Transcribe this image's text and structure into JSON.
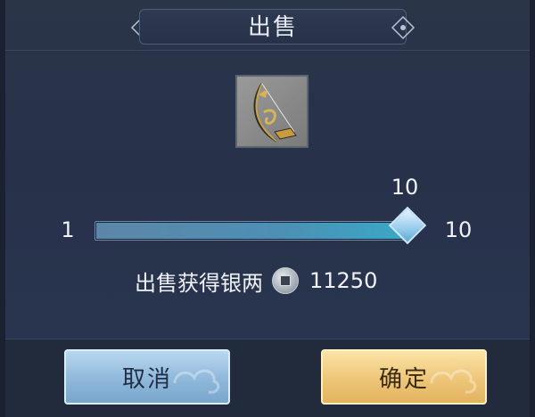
{
  "dialog": {
    "title": "出售"
  },
  "item": {
    "icon": "bow-icon"
  },
  "quantity": {
    "min_label": "1",
    "max_label": "10",
    "current_label": "10",
    "min": 1,
    "max": 10,
    "value": 10
  },
  "proceeds": {
    "label": "出售获得银两",
    "currency_icon": "silver-coin-icon",
    "amount": "11250"
  },
  "buttons": {
    "cancel_label": "取消",
    "confirm_label": "确定"
  },
  "colors": {
    "panel": "#27314a",
    "cancel": "#8fb8da",
    "confirm": "#eec679",
    "slider_fill": "#4c90b4"
  }
}
